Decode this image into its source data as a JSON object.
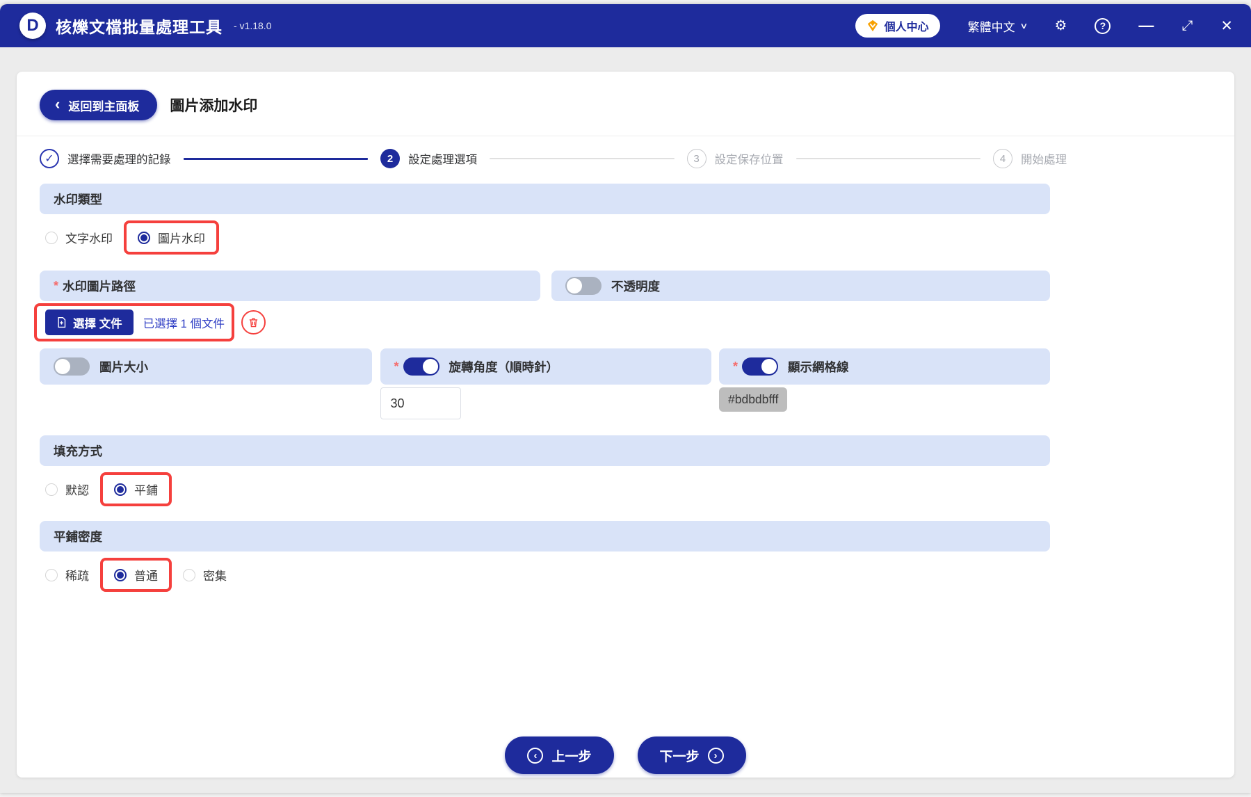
{
  "titlebar": {
    "logo_letter": "D",
    "app_title": "核爍文檔批量處理工具",
    "version": "- v1.18.0",
    "user_center": "個人中心",
    "language": "繁體中文"
  },
  "icons": {
    "check": "✓",
    "chevron_left": "‹",
    "chevron_right": "›",
    "chevron_down": "∨",
    "gear": "⚙",
    "help": "?",
    "minimize": "—",
    "maximize": "⤢",
    "close": "✕"
  },
  "header": {
    "back_label": "返回到主面板",
    "page_title": "圖片添加水印"
  },
  "steps": [
    {
      "num": "✓",
      "label": "選擇需要處理的記錄",
      "state": "done"
    },
    {
      "num": "2",
      "label": "設定處理選項",
      "state": "active"
    },
    {
      "num": "3",
      "label": "設定保存位置",
      "state": "todo"
    },
    {
      "num": "4",
      "label": "開始處理",
      "state": "todo"
    }
  ],
  "watermark_type": {
    "title": "水印類型",
    "options": [
      {
        "label": "文字水印",
        "selected": false
      },
      {
        "label": "圖片水印",
        "selected": true,
        "highlighted": true
      }
    ]
  },
  "image_path": {
    "required": "*",
    "label": "水印圖片路徑",
    "choose_file": "選擇 文件",
    "selected_info": "已選擇 1 個文件"
  },
  "opacity": {
    "label": "不透明度",
    "enabled": false
  },
  "image_size": {
    "label": "圖片大小",
    "enabled": false
  },
  "rotation": {
    "required": "*",
    "label": "旋轉角度（順時針）",
    "enabled": true,
    "value": "30"
  },
  "grid": {
    "required": "*",
    "label": "顯示網格線",
    "enabled": true,
    "color_value": "#bdbdbfff"
  },
  "fill_mode": {
    "title": "填充方式",
    "options": [
      {
        "label": "默認",
        "selected": false
      },
      {
        "label": "平鋪",
        "selected": true,
        "highlighted": true
      }
    ]
  },
  "tile_density": {
    "title": "平鋪密度",
    "options": [
      {
        "label": "稀疏",
        "selected": false
      },
      {
        "label": "普通",
        "selected": true,
        "highlighted": true
      },
      {
        "label": "密集",
        "selected": false
      }
    ]
  },
  "footer": {
    "prev": "上一步",
    "next": "下一步"
  },
  "colors": {
    "primary": "#1e2b9c",
    "band_background": "#d9e3f8",
    "highlight_red": "#f5403d",
    "required_red": "#f56c6c",
    "link_blue": "#2d3cc4",
    "badge_gray": "#bdbdbd",
    "gem_orange": "#f7a000"
  }
}
